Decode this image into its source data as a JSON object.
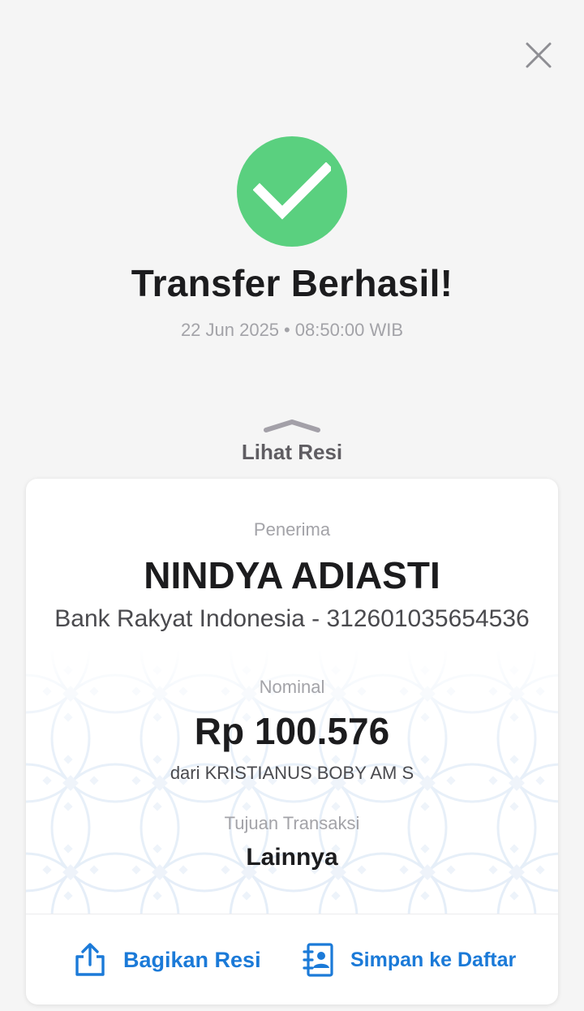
{
  "header": {
    "close_icon": "close-icon"
  },
  "status": {
    "icon": "checkmark-icon",
    "color": "#5ad07f",
    "title": "Transfer Berhasil!",
    "date": "22 Jun 2025",
    "separator": "•",
    "time": "08:50:00 WIB"
  },
  "resi_toggle": {
    "label": "Lihat Resi",
    "icon": "chevron-up-icon"
  },
  "receipt": {
    "recipient_label": "Penerima",
    "recipient_name": "NINDYA ADIASTI",
    "bank_account": "Bank Rakyat Indonesia - 312601035654536",
    "nominal_label": "Nominal",
    "amount": "Rp 100.576",
    "sender": "dari KRISTIANUS BOBY AM S",
    "purpose_label": "Tujuan Transaksi",
    "purpose_value": "Lainnya"
  },
  "actions": {
    "share_label": "Bagikan Resi",
    "share_icon": "share-icon",
    "save_label": "Simpan ke Daftar",
    "save_icon": "contact-book-icon",
    "accent": "#1b7ad8"
  }
}
